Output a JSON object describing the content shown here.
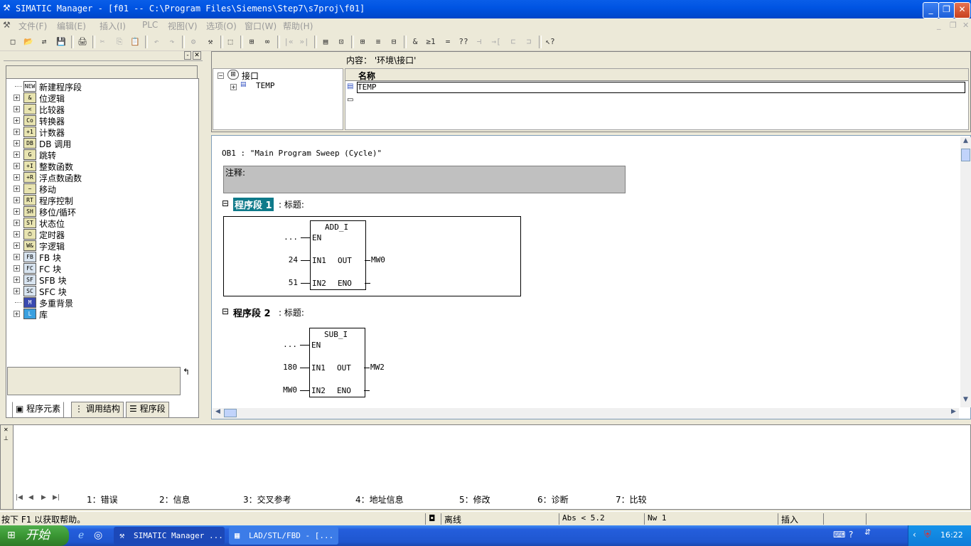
{
  "window": {
    "title": "SIMATIC Manager - [f01 -- C:\\Program Files\\Siemens\\Step7\\s7proj\\f01]",
    "min": "_",
    "max": "❐",
    "close": "✕"
  },
  "menu": [
    "文件(F)",
    "编辑(E)",
    "插入(I)",
    "PLC",
    "视图(V)",
    "选项(O)",
    "窗口(W)",
    "帮助(H)"
  ],
  "toolbar": [
    "□",
    "📂",
    "⇄",
    "💾",
    "🖨",
    "✂",
    "⎘",
    "📋",
    "↶",
    "↷",
    "⚙",
    "⚒",
    "⬚",
    "⊞",
    "∞",
    "|«",
    "»|",
    "▤",
    "⊡",
    "⊞",
    "≡",
    "⊟",
    "&",
    "≥1",
    "=",
    "??",
    "⊣",
    "→[",
    "⊏",
    "⊐",
    "↖?"
  ],
  "left": {
    "items": [
      {
        "label": "新建程序段",
        "icon": "NEW",
        "expandable": false
      },
      {
        "label": "位逻辑",
        "icon": "&",
        "expandable": true
      },
      {
        "label": "比较器",
        "icon": "<",
        "expandable": true
      },
      {
        "label": "转换器",
        "icon": "Co",
        "expandable": true
      },
      {
        "label": "计数器",
        "icon": "+1",
        "expandable": true
      },
      {
        "label": "DB 调用",
        "icon": "DB",
        "expandable": true
      },
      {
        "label": "跳转",
        "icon": "G",
        "expandable": true
      },
      {
        "label": "整数函数",
        "icon": "+I",
        "expandable": true
      },
      {
        "label": "浮点数函数",
        "icon": "+R",
        "expandable": true
      },
      {
        "label": "移动",
        "icon": "~",
        "expandable": true
      },
      {
        "label": "程序控制",
        "icon": "RT",
        "expandable": true
      },
      {
        "label": "移位/循环",
        "icon": "SH",
        "expandable": true
      },
      {
        "label": "状态位",
        "icon": "ST",
        "expandable": true
      },
      {
        "label": "定时器",
        "icon": "⏱",
        "expandable": true
      },
      {
        "label": "字逻辑",
        "icon": "W&",
        "expandable": true
      },
      {
        "label": "FB 块",
        "icon": "FB",
        "expandable": true
      },
      {
        "label": "FC 块",
        "icon": "FC",
        "expandable": true
      },
      {
        "label": "SFB 块",
        "icon": "SF",
        "expandable": true
      },
      {
        "label": "SFC 块",
        "icon": "SC",
        "expandable": true
      },
      {
        "label": "多重背景",
        "icon": "M",
        "expandable": false
      },
      {
        "label": "库",
        "icon": "L",
        "expandable": true
      }
    ],
    "tabs": [
      "程序元素",
      "调用结构",
      "程序段"
    ]
  },
  "iface": {
    "content_label": "内容： '环境\\接口'",
    "tree_root": "接口",
    "tree_child": "TEMP",
    "col_name": "名称",
    "row1": "TEMP"
  },
  "editor": {
    "block_title": "OB1 :  \"Main Program Sweep (Cycle)\"",
    "comment_label": "注释:",
    "network1": {
      "label": "程序段 1",
      "title": ": 标题:",
      "func": "ADD_I",
      "en": "...",
      "in1": "24",
      "in2": "51",
      "out": "MW0",
      "pin_en": "EN",
      "pin_in1": "IN1",
      "pin_in2": "IN2",
      "pin_out": "OUT",
      "pin_eno": "ENO"
    },
    "network2": {
      "label": "程序段 2",
      "title": ": 标题:",
      "func": "SUB_I",
      "en": "...",
      "in1": "180",
      "in2": "MW0",
      "out": "MW2",
      "pin_en": "EN",
      "pin_in1": "IN1",
      "pin_in2": "IN2",
      "pin_out": "OUT",
      "pin_eno": "ENO"
    }
  },
  "output_tabs": [
    "1：错误",
    "2：信息",
    "3：交叉参考",
    "4：地址信息",
    "5：修改",
    "6：诊断",
    "7：比较"
  ],
  "status": {
    "help": "按下 F1 以获取帮助。",
    "mode": "离线",
    "abs": "Abs < 5.2",
    "nw": "Nw 1",
    "ins": "插入"
  },
  "taskbar": {
    "start": "开始",
    "task1": "SIMATIC Manager ...",
    "task2": "LAD/STL/FBD  - [...",
    "clock": "16:22"
  }
}
